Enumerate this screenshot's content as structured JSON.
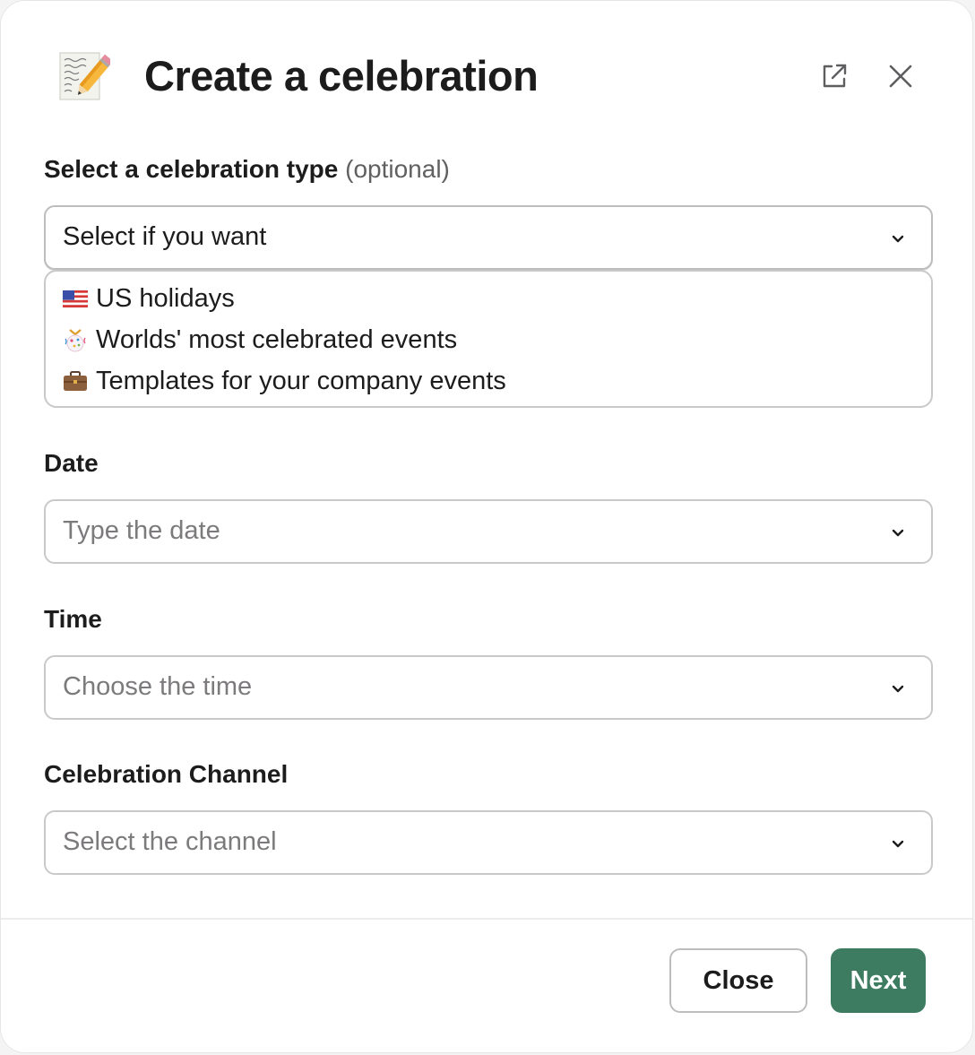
{
  "modal": {
    "title": "Create a celebration",
    "app_icon": "memo-pencil-icon"
  },
  "header_actions": {
    "popout_icon": "external-link-icon",
    "close_icon": "close-icon"
  },
  "celebration_type": {
    "label": "Select a celebration type",
    "optional_text": "(optional)",
    "value": "Select if you want",
    "options": [
      {
        "icon": "us-flag-icon",
        "label": "US holidays"
      },
      {
        "icon": "confetti-ball-icon",
        "label": "Worlds' most celebrated events"
      },
      {
        "icon": "briefcase-icon",
        "label": "Templates for your company events"
      }
    ]
  },
  "date": {
    "label": "Date",
    "placeholder": "Type the date"
  },
  "time": {
    "label": "Time",
    "placeholder": "Choose the time"
  },
  "channel": {
    "label": "Celebration Channel",
    "placeholder": "Select the channel"
  },
  "footer": {
    "close_label": "Close",
    "next_label": "Next"
  },
  "colors": {
    "primary": "#3e7c61",
    "text": "#1d1c1d",
    "placeholder": "#7c7a7c",
    "border": "#c9c9c9"
  }
}
